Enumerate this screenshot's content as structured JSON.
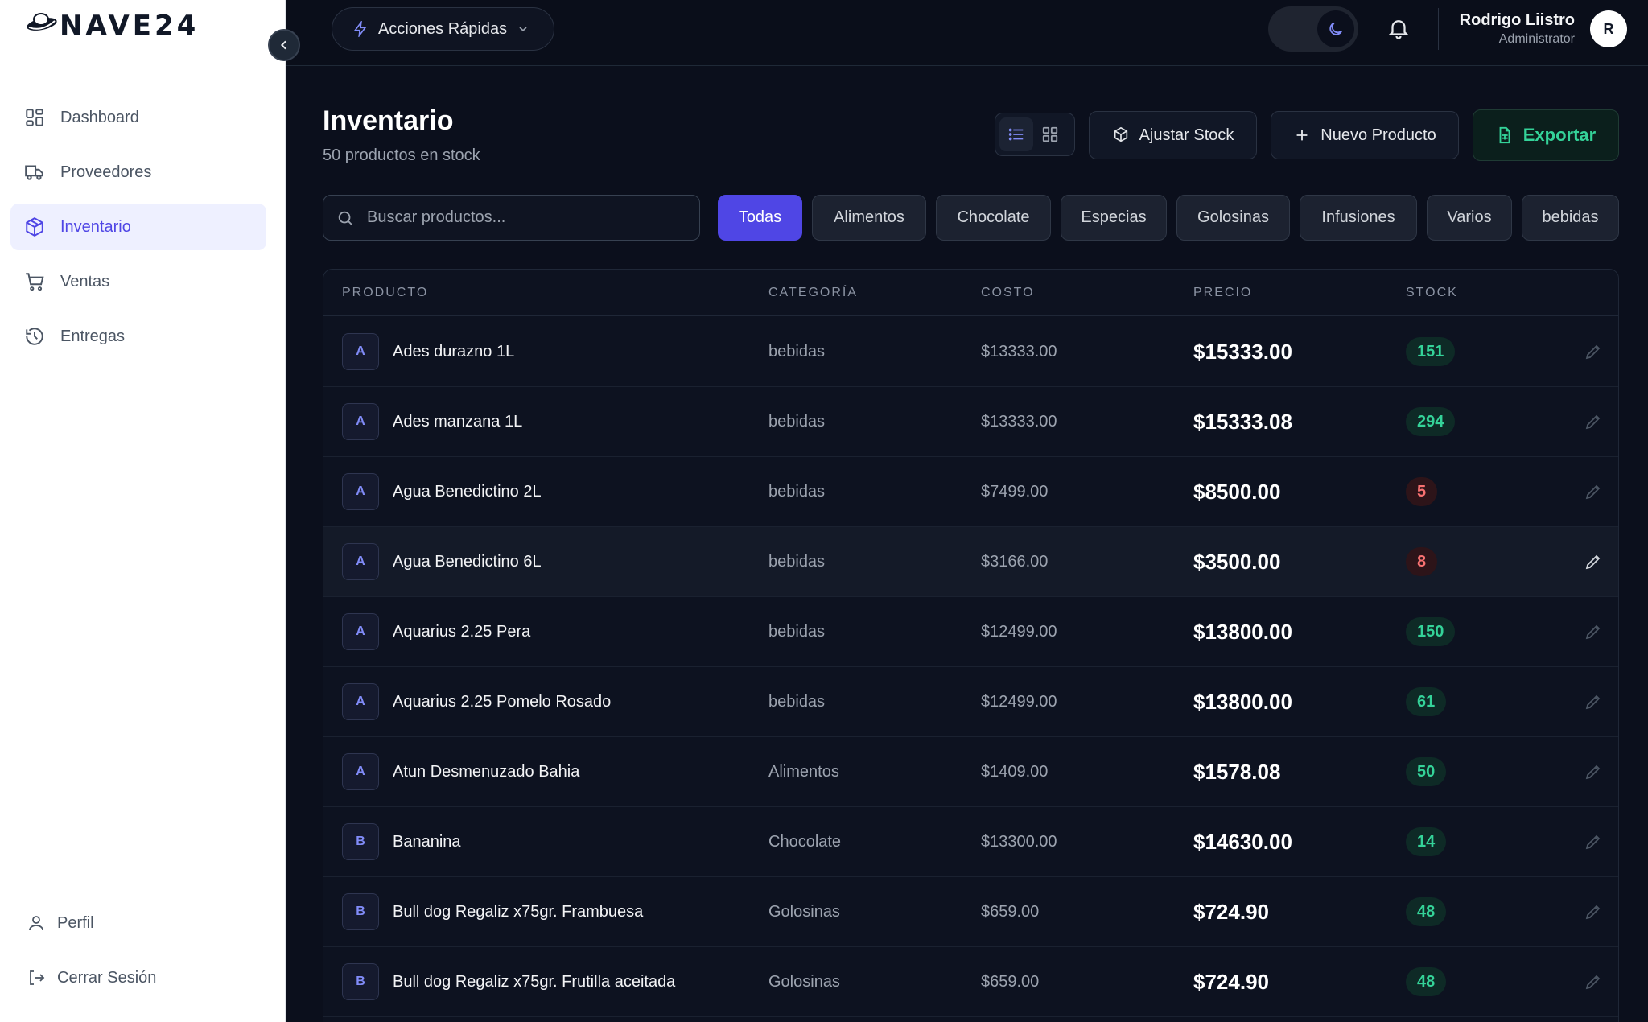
{
  "app": {
    "name": "NAVE24"
  },
  "sidebar": {
    "items": [
      {
        "label": "Dashboard",
        "icon": "dashboard-icon",
        "active": false
      },
      {
        "label": "Proveedores",
        "icon": "truck-icon",
        "active": false
      },
      {
        "label": "Inventario",
        "icon": "package-icon",
        "active": true
      },
      {
        "label": "Ventas",
        "icon": "cart-icon",
        "active": false
      },
      {
        "label": "Entregas",
        "icon": "history-icon",
        "active": false
      }
    ],
    "bottom": [
      {
        "label": "Perfil",
        "icon": "user-icon"
      },
      {
        "label": "Cerrar Sesión",
        "icon": "logout-icon"
      }
    ]
  },
  "topbar": {
    "quick_actions": "Acciones Rápidas",
    "user_name": "Rodrigo Liistro",
    "user_role": "Administrator",
    "avatar_initial": "R"
  },
  "page": {
    "title": "Inventario",
    "subtitle": "50 productos en stock",
    "adjust_stock": "Ajustar Stock",
    "new_product": "Nuevo Producto",
    "export": "Exportar",
    "search_placeholder": "Buscar productos..."
  },
  "filters": [
    "Todas",
    "Alimentos",
    "Chocolate",
    "Especias",
    "Golosinas",
    "Infusiones",
    "Varios",
    "bebidas"
  ],
  "active_filter": "Todas",
  "table": {
    "headers": {
      "product": "PRODUCTO",
      "category": "CATEGORÍA",
      "cost": "COSTO",
      "price": "PRECIO",
      "stock": "STOCK"
    },
    "rows": [
      {
        "initial": "A",
        "name": "Ades durazno 1L",
        "category": "bebidas",
        "cost": "$13333.00",
        "price": "$15333.00",
        "stock": "151",
        "status": "ok"
      },
      {
        "initial": "A",
        "name": "Ades manzana 1L",
        "category": "bebidas",
        "cost": "$13333.00",
        "price": "$15333.08",
        "stock": "294",
        "status": "ok"
      },
      {
        "initial": "A",
        "name": "Agua Benedictino 2L",
        "category": "bebidas",
        "cost": "$7499.00",
        "price": "$8500.00",
        "stock": "5",
        "status": "low"
      },
      {
        "initial": "A",
        "name": "Agua Benedictino 6L",
        "category": "bebidas",
        "cost": "$3166.00",
        "price": "$3500.00",
        "stock": "8",
        "status": "low"
      },
      {
        "initial": "A",
        "name": "Aquarius 2.25 Pera",
        "category": "bebidas",
        "cost": "$12499.00",
        "price": "$13800.00",
        "stock": "150",
        "status": "ok"
      },
      {
        "initial": "A",
        "name": "Aquarius 2.25 Pomelo Rosado",
        "category": "bebidas",
        "cost": "$12499.00",
        "price": "$13800.00",
        "stock": "61",
        "status": "ok"
      },
      {
        "initial": "A",
        "name": "Atun Desmenuzado Bahia",
        "category": "Alimentos",
        "cost": "$1409.00",
        "price": "$1578.08",
        "stock": "50",
        "status": "ok"
      },
      {
        "initial": "B",
        "name": "Bananina",
        "category": "Chocolate",
        "cost": "$13300.00",
        "price": "$14630.00",
        "stock": "14",
        "status": "ok"
      },
      {
        "initial": "B",
        "name": "Bull dog Regaliz x75gr. Frambuesa",
        "category": "Golosinas",
        "cost": "$659.00",
        "price": "$724.90",
        "stock": "48",
        "status": "ok"
      },
      {
        "initial": "B",
        "name": "Bull dog Regaliz x75gr. Frutilla aceitada",
        "category": "Golosinas",
        "cost": "$659.00",
        "price": "$724.90",
        "stock": "48",
        "status": "ok"
      }
    ]
  },
  "colors": {
    "accent": "#4f46e5",
    "background": "#0b0f1c",
    "stock_ok": "#34d399",
    "stock_low": "#f87171",
    "export": "#34d399"
  }
}
